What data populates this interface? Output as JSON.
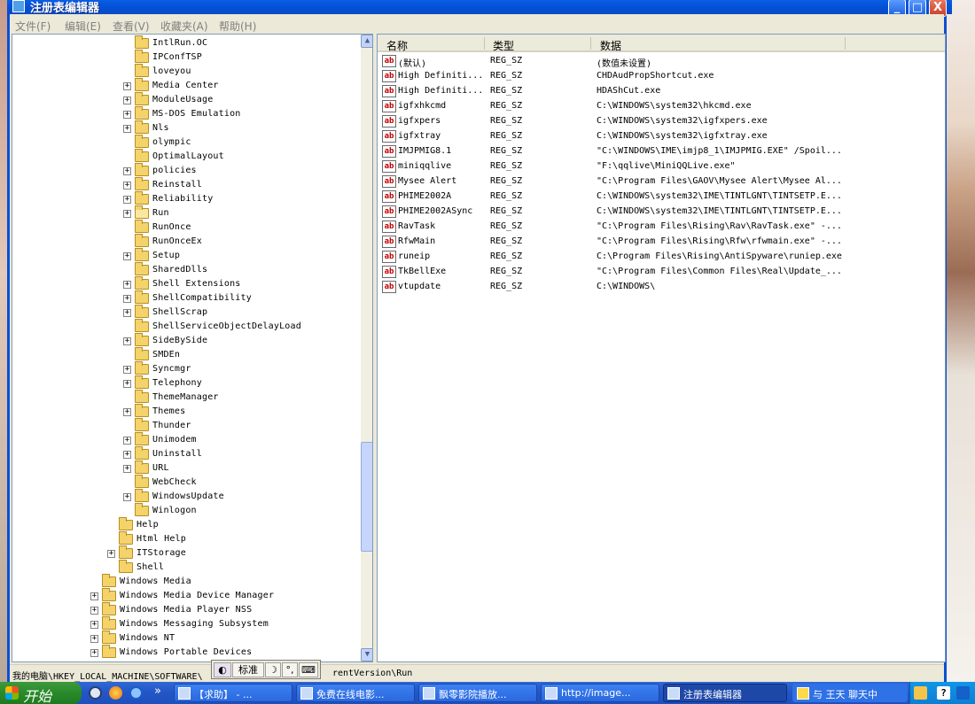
{
  "window": {
    "title": "注册表编辑器",
    "controls": {
      "minimize": "_",
      "maximize": "□",
      "close": "X"
    }
  },
  "menu": [
    "文件(F)",
    "编辑(E)",
    "查看(V)",
    "收藏夹(A)",
    "帮助(H)"
  ],
  "tree": {
    "items": [
      {
        "label": "IntlRun.OC",
        "expandable": false
      },
      {
        "label": "IPConfTSP",
        "expandable": false
      },
      {
        "label": "loveyou",
        "expandable": false
      },
      {
        "label": "Media Center",
        "expandable": true
      },
      {
        "label": "ModuleUsage",
        "expandable": true
      },
      {
        "label": "MS-DOS Emulation",
        "expandable": true
      },
      {
        "label": "Nls",
        "expandable": true
      },
      {
        "label": "olympic",
        "expandable": false
      },
      {
        "label": "OptimalLayout",
        "expandable": false
      },
      {
        "label": "policies",
        "expandable": true
      },
      {
        "label": "Reinstall",
        "expandable": true
      },
      {
        "label": "Reliability",
        "expandable": true
      },
      {
        "label": "Run",
        "expandable": true,
        "selected": true
      },
      {
        "label": "RunOnce",
        "expandable": false
      },
      {
        "label": "RunOnceEx",
        "expandable": false
      },
      {
        "label": "Setup",
        "expandable": true
      },
      {
        "label": "SharedDlls",
        "expandable": false
      },
      {
        "label": "Shell Extensions",
        "expandable": true
      },
      {
        "label": "ShellCompatibility",
        "expandable": true
      },
      {
        "label": "ShellScrap",
        "expandable": true
      },
      {
        "label": "ShellServiceObjectDelayLoad",
        "expandable": false
      },
      {
        "label": "SideBySide",
        "expandable": true
      },
      {
        "label": "SMDEn",
        "expandable": false
      },
      {
        "label": "Syncmgr",
        "expandable": true
      },
      {
        "label": "Telephony",
        "expandable": true
      },
      {
        "label": "ThemeManager",
        "expandable": false
      },
      {
        "label": "Themes",
        "expandable": true
      },
      {
        "label": "Thunder",
        "expandable": false
      },
      {
        "label": "Unimodem",
        "expandable": true
      },
      {
        "label": "Uninstall",
        "expandable": true
      },
      {
        "label": "URL",
        "expandable": true
      },
      {
        "label": "WebCheck",
        "expandable": false
      },
      {
        "label": "WindowsUpdate",
        "expandable": true
      },
      {
        "label": "Winlogon",
        "expandable": false
      },
      {
        "label": "Help",
        "expandable": false
      },
      {
        "label": "Html Help",
        "expandable": false
      },
      {
        "label": "ITStorage",
        "expandable": true
      },
      {
        "label": "Shell",
        "expandable": false
      },
      {
        "label": "Windows Media",
        "expandable": false
      },
      {
        "label": "Windows Media Device Manager",
        "expandable": true
      },
      {
        "label": "Windows Media Player NSS",
        "expandable": true
      },
      {
        "label": "Windows Messaging Subsystem",
        "expandable": true
      },
      {
        "label": "Windows NT",
        "expandable": true
      },
      {
        "label": "Windows Portable Devices",
        "expandable": true
      }
    ],
    "scroll_up": "▲",
    "scroll_down": "▼"
  },
  "list": {
    "columns": [
      "名称",
      "类型",
      "数据"
    ],
    "type_icon": "ab",
    "rows": [
      {
        "name": "(默认)",
        "type": "REG_SZ",
        "data": "(数值未设置)"
      },
      {
        "name": "High Definiti...",
        "type": "REG_SZ",
        "data": "CHDAudPropShortcut.exe"
      },
      {
        "name": "High Definiti...",
        "type": "REG_SZ",
        "data": "HDAShCut.exe"
      },
      {
        "name": "igfxhkcmd",
        "type": "REG_SZ",
        "data": "C:\\WINDOWS\\system32\\hkcmd.exe"
      },
      {
        "name": "igfxpers",
        "type": "REG_SZ",
        "data": "C:\\WINDOWS\\system32\\igfxpers.exe"
      },
      {
        "name": "igfxtray",
        "type": "REG_SZ",
        "data": "C:\\WINDOWS\\system32\\igfxtray.exe"
      },
      {
        "name": "IMJPMIG8.1",
        "type": "REG_SZ",
        "data": "\"C:\\WINDOWS\\IME\\imjp8_1\\IMJPMIG.EXE\" /Spoil..."
      },
      {
        "name": "miniqqlive",
        "type": "REG_SZ",
        "data": "\"F:\\qqlive\\MiniQQLive.exe\""
      },
      {
        "name": "Mysee Alert",
        "type": "REG_SZ",
        "data": "\"C:\\Program Files\\GAOV\\Mysee Alert\\Mysee Al..."
      },
      {
        "name": "PHIME2002A",
        "type": "REG_SZ",
        "data": "C:\\WINDOWS\\system32\\IME\\TINTLGNT\\TINTSETP.E..."
      },
      {
        "name": "PHIME2002ASync",
        "type": "REG_SZ",
        "data": "C:\\WINDOWS\\system32\\IME\\TINTLGNT\\TINTSETP.E..."
      },
      {
        "name": "RavTask",
        "type": "REG_SZ",
        "data": "\"C:\\Program Files\\Rising\\Rav\\RavTask.exe\" -..."
      },
      {
        "name": "RfwMain",
        "type": "REG_SZ",
        "data": "\"C:\\Program Files\\Rising\\Rfw\\rfwmain.exe\" -..."
      },
      {
        "name": "runeip",
        "type": "REG_SZ",
        "data": "C:\\Program Files\\Rising\\AntiSpyware\\runiep.exe"
      },
      {
        "name": "TkBellExe",
        "type": "REG_SZ",
        "data": "\"C:\\Program Files\\Common Files\\Real\\Update_..."
      },
      {
        "name": "vtupdate",
        "type": "REG_SZ",
        "data": "C:\\WINDOWS\\"
      }
    ]
  },
  "status": {
    "path_before": "我的电脑\\HKEY_LOCAL_MACHINE\\SOFTWARE\\",
    "path_after": "rentVersion\\Run"
  },
  "ime": {
    "mode": "标准",
    "moon": "☽",
    "punct": "°,",
    "keyboard": "⌨"
  },
  "taskbar": {
    "start": "开始",
    "more": "»",
    "tasks": [
      "【求助】 - ...",
      "免费在线电影...",
      "飘零影院播放...",
      "http://image...",
      "注册表编辑器",
      "与 王天 聊天中"
    ],
    "active_index": 4
  },
  "colors": {
    "titlebar": "#0a5fe4",
    "taskbar": "#2456c7",
    "start": "#2a8a2a",
    "regsz_icon": "#c00000"
  }
}
